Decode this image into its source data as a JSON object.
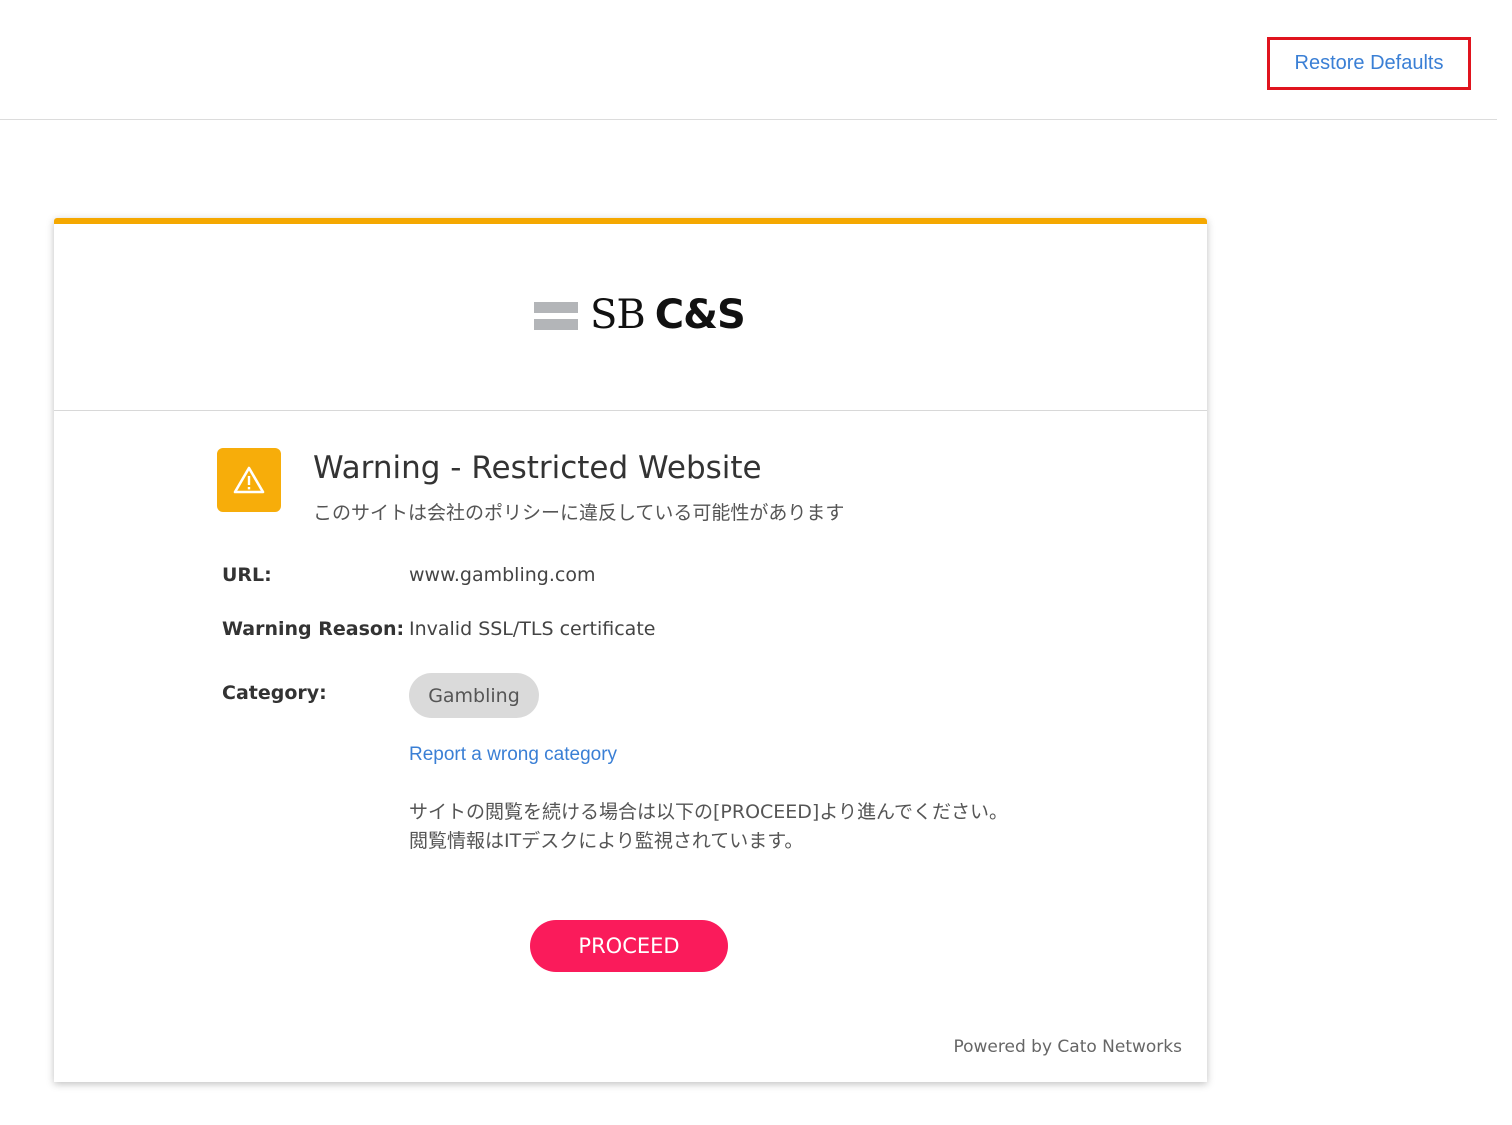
{
  "header": {
    "restore_label": "Restore Defaults"
  },
  "card": {
    "brand_logo_text_a": "SB",
    "brand_logo_text_b": "C&S",
    "title": "Warning - Restricted Website",
    "subtitle": "このサイトは会社のポリシーに違反している可能性があります",
    "fields": {
      "url_label": "URL:",
      "url_value": "www.gambling.com",
      "reason_label": "Warning Reason:",
      "reason_value": "Invalid SSL/TLS certificate",
      "category_label": "Category:",
      "category_value": "Gambling"
    },
    "report_link": "Report a wrong category",
    "info_line1": "サイトの閲覧を続ける場合は以下の[PROCEED]より進んでください。",
    "info_line2": "閲覧情報はITデスクにより監視されています。",
    "proceed_label": "PROCEED",
    "footer": "Powered by Cato Networks"
  },
  "colors": {
    "accent_top_border": "#f5a800",
    "warning_icon_bg": "#f7ad0a",
    "proceed_button": "#fa1b5b",
    "link": "#3a7fd5",
    "highlight_box": "#e0141e"
  },
  "icons": {
    "warning": "warning-triangle-icon",
    "logo_bars": "logo-bars-icon"
  }
}
